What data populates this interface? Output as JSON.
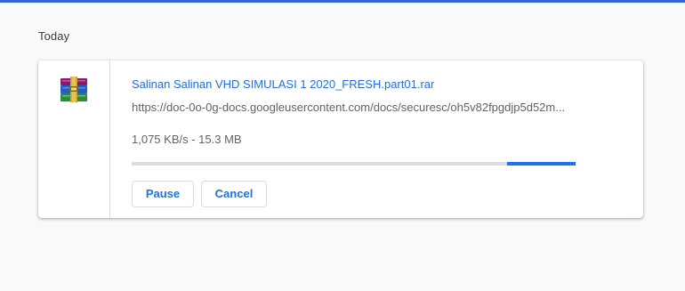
{
  "section": {
    "heading": "Today"
  },
  "download": {
    "icon": "winrar-archive-icon",
    "file_name": "Salinan Salinan VHD SIMULASI 1 2020_FRESH.part01.rar",
    "url": "https://doc-0o-0g-docs.googleusercontent.com/docs/securesc/oh5v82fpgdjp5d52m...",
    "status": "1,075 KB/s - 15.3 MB",
    "progress": {
      "indeterminate": true,
      "visible_segment_start": 0.845,
      "visible_segment_end": 1.0
    },
    "buttons": {
      "pause_label": "Pause",
      "cancel_label": "Cancel"
    }
  },
  "colors": {
    "accent": "#1a73e8",
    "top_bar": "#3367d6",
    "background": "#f8f9fa"
  }
}
